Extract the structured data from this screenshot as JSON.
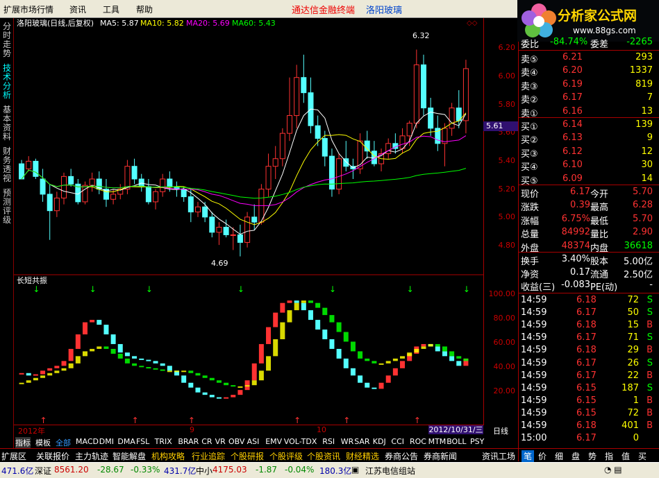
{
  "menu": [
    "扩展市场行情",
    "资讯",
    "工具",
    "帮助"
  ],
  "brand": {
    "left": "通达信金融终端",
    "right": "洛阳玻璃"
  },
  "logo": {
    "title": "分析家公式网",
    "url": "www.88gs.com"
  },
  "vtabs": [
    "分时走势",
    "技术分析",
    "基本资料",
    "财务透视",
    "预测评级"
  ],
  "chart": {
    "stock": "洛阳玻璃(日线,后复权)",
    "ma5": "MA5: 5.87",
    "ma10": "MA10: 5.82",
    "ma20": "MA20: 5.69",
    "ma60": "MA60: 5.43",
    "y_ticks": [
      "6.20",
      "6.00",
      "5.80",
      "5.60",
      "5.40",
      "5.20",
      "5.00",
      "4.80"
    ],
    "high_label": "6.32",
    "low_label": "4.69",
    "last_price": "5.61",
    "ind_title": "长短共振",
    "ind_ticks": [
      "100.00",
      "80.00",
      "60.00",
      "40.00",
      "20.00"
    ],
    "x_ticks": [
      "2012年",
      "9",
      "10"
    ],
    "date_box": "2012/10/31/三",
    "cycle": "日线"
  },
  "chart_data": {
    "type": "candlestick",
    "price_ylim": [
      4.6,
      6.35
    ],
    "indicator_ylim": [
      0,
      105
    ],
    "candles": [
      [
        5.42,
        5.45,
        5.33,
        5.3
      ],
      [
        5.38,
        5.48,
        5.36,
        5.44
      ],
      [
        5.44,
        5.46,
        5.3,
        5.32
      ],
      [
        5.3,
        5.38,
        5.12,
        5.18
      ],
      [
        5.18,
        5.26,
        4.82,
        5.05
      ],
      [
        5.05,
        5.2,
        5.0,
        5.15
      ],
      [
        5.15,
        5.35,
        5.1,
        5.32
      ],
      [
        5.32,
        5.38,
        5.24,
        5.26
      ],
      [
        5.26,
        5.3,
        5.1,
        5.12
      ],
      [
        5.12,
        5.28,
        5.1,
        5.25
      ],
      [
        5.25,
        5.35,
        5.2,
        5.3
      ],
      [
        5.3,
        5.36,
        5.18,
        5.22
      ],
      [
        5.22,
        5.3,
        5.08,
        5.14
      ],
      [
        5.14,
        5.22,
        5.1,
        5.18
      ],
      [
        5.18,
        5.26,
        5.14,
        5.22
      ],
      [
        5.22,
        5.45,
        5.18,
        5.4
      ],
      [
        5.4,
        5.46,
        5.26,
        5.3
      ],
      [
        5.3,
        5.34,
        5.2,
        5.24
      ],
      [
        5.24,
        5.3,
        5.1,
        5.12
      ],
      [
        5.12,
        5.22,
        5.06,
        5.2
      ],
      [
        5.2,
        5.34,
        5.16,
        5.3
      ],
      [
        5.3,
        5.36,
        5.2,
        5.24
      ],
      [
        5.24,
        5.28,
        5.16,
        5.22
      ],
      [
        5.22,
        5.24,
        5.12,
        5.16
      ],
      [
        5.16,
        5.22,
        4.96,
        5.04
      ],
      [
        5.04,
        5.12,
        5.0,
        5.08
      ],
      [
        5.08,
        5.12,
        4.96,
        5.0
      ],
      [
        5.0,
        5.04,
        4.84,
        4.88
      ],
      [
        4.88,
        4.96,
        4.78,
        4.92
      ],
      [
        4.92,
        4.98,
        4.84,
        4.86
      ],
      [
        4.86,
        4.92,
        4.74,
        4.86
      ],
      [
        4.86,
        4.94,
        4.69,
        4.8
      ],
      [
        4.8,
        5.04,
        4.76,
        5.0
      ],
      [
        5.0,
        5.1,
        4.9,
        4.96
      ],
      [
        4.96,
        5.26,
        4.94,
        5.22
      ],
      [
        5.22,
        5.5,
        5.16,
        5.4
      ],
      [
        5.4,
        5.56,
        5.3,
        5.46
      ],
      [
        5.46,
        5.7,
        5.4,
        5.66
      ],
      [
        5.66,
        6.1,
        5.6,
        5.8
      ],
      [
        5.8,
        6.2,
        5.7,
        6.1
      ],
      [
        6.1,
        6.28,
        5.9,
        5.98
      ],
      [
        5.98,
        6.1,
        5.66,
        5.72
      ],
      [
        5.72,
        5.8,
        5.56,
        5.62
      ],
      [
        5.62,
        5.68,
        5.4,
        5.48
      ],
      [
        5.48,
        5.54,
        5.16,
        5.22
      ],
      [
        5.22,
        5.5,
        5.18,
        5.46
      ],
      [
        5.46,
        5.6,
        5.36,
        5.4
      ],
      [
        5.4,
        5.46,
        5.3,
        5.38
      ],
      [
        5.38,
        5.66,
        5.34,
        5.6
      ],
      [
        5.6,
        5.68,
        5.46,
        5.52
      ],
      [
        5.52,
        5.6,
        5.4,
        5.42
      ],
      [
        5.42,
        5.54,
        5.36,
        5.5
      ],
      [
        5.5,
        5.62,
        5.46,
        5.58
      ],
      [
        5.58,
        5.66,
        5.5,
        5.54
      ],
      [
        5.54,
        5.7,
        5.5,
        5.64
      ],
      [
        5.64,
        5.76,
        5.56,
        5.74
      ],
      [
        5.74,
        6.32,
        5.7,
        6.2
      ],
      [
        6.2,
        6.28,
        5.8,
        5.86
      ],
      [
        5.86,
        5.94,
        5.64,
        5.7
      ],
      [
        5.7,
        5.8,
        5.52,
        5.58
      ],
      [
        5.58,
        5.74,
        5.4,
        5.7
      ],
      [
        5.7,
        5.9,
        5.64,
        5.86
      ],
      [
        5.86,
        6.0,
        5.7,
        5.76
      ],
      [
        5.76,
        6.24,
        5.66,
        6.17
      ]
    ],
    "indicator": [
      38,
      36,
      37,
      40,
      42,
      44,
      48,
      58,
      70,
      80,
      82,
      78,
      70,
      62,
      55,
      52,
      50,
      49,
      48,
      46,
      44,
      40,
      36,
      30,
      26,
      22,
      20,
      18,
      17,
      18,
      20,
      24,
      32,
      46,
      62,
      76,
      88,
      96,
      98,
      96,
      90,
      82,
      74,
      66,
      58,
      50,
      42,
      36,
      30,
      26,
      25,
      30,
      36,
      42,
      48,
      54,
      60,
      62,
      60,
      56,
      52,
      48,
      44,
      50
    ],
    "indicator_fast": [
      30,
      32,
      34,
      36,
      38,
      40,
      42,
      46,
      52,
      56,
      58,
      60,
      58,
      54,
      50,
      46,
      44,
      43,
      42,
      41,
      40,
      40,
      40,
      40,
      38,
      36,
      34,
      32,
      30,
      28,
      27,
      27,
      28,
      32,
      40,
      52,
      66,
      80,
      90,
      96,
      98,
      96,
      92,
      86,
      80,
      72,
      64,
      56,
      50,
      48,
      46,
      46,
      48,
      50,
      52,
      55,
      58,
      60,
      62,
      60,
      56,
      52,
      50,
      48
    ]
  },
  "right_panel": {
    "wb": {
      "label": "委比",
      "val": "-84.74%",
      "label2": "委差",
      "val2": "-2265"
    },
    "asks": [
      [
        "卖⑤",
        "6.21",
        "293"
      ],
      [
        "卖④",
        "6.20",
        "1337"
      ],
      [
        "卖③",
        "6.19",
        "819"
      ],
      [
        "卖②",
        "6.17",
        "7"
      ],
      [
        "卖①",
        "6.16",
        "13"
      ]
    ],
    "bids": [
      [
        "买①",
        "6.14",
        "139"
      ],
      [
        "买②",
        "6.13",
        "9"
      ],
      [
        "买③",
        "6.12",
        "12"
      ],
      [
        "买④",
        "6.10",
        "30"
      ],
      [
        "买⑤",
        "6.09",
        "14"
      ]
    ],
    "quote": [
      [
        "现价",
        "6.17",
        "今开",
        "5.70"
      ],
      [
        "涨跌",
        "0.39",
        "最高",
        "6.28"
      ],
      [
        "涨幅",
        "6.75%",
        "最低",
        "5.70"
      ],
      [
        "总量",
        "84992",
        "量比",
        "2.90"
      ],
      [
        "外盘",
        "48374",
        "内盘",
        "36618"
      ]
    ],
    "fund": [
      [
        "换手",
        "3.40%",
        "股本",
        "5.00亿"
      ],
      [
        "净资",
        "0.17",
        "流通",
        "2.50亿"
      ],
      [
        "收益(三)",
        "-0.083",
        "PE(动)",
        "-"
      ]
    ],
    "ticks": [
      [
        "14:59",
        "6.18",
        "72",
        "S"
      ],
      [
        "14:59",
        "6.17",
        "50",
        "S"
      ],
      [
        "14:59",
        "6.18",
        "15",
        "B"
      ],
      [
        "14:59",
        "6.17",
        "71",
        "S"
      ],
      [
        "14:59",
        "6.18",
        "29",
        "B"
      ],
      [
        "14:59",
        "6.17",
        "26",
        "S"
      ],
      [
        "14:59",
        "6.17",
        "22",
        "B"
      ],
      [
        "14:59",
        "6.15",
        "187",
        "S"
      ],
      [
        "14:59",
        "6.15",
        "1",
        "B"
      ],
      [
        "14:59",
        "6.15",
        "72",
        "B"
      ],
      [
        "14:59",
        "6.18",
        "401",
        "B"
      ],
      [
        "15:00",
        "6.17",
        "0",
        ""
      ]
    ]
  },
  "indicators": [
    "指标",
    "模板",
    "全部",
    "MACD",
    "DMI",
    "DMA",
    "FSL",
    "TRIX",
    "BRAR",
    "CR",
    "VR",
    "OBV",
    "ASI",
    "EMV",
    "VOL-TDX",
    "RSI",
    "WR",
    "SAR",
    "KDJ",
    "CCI",
    "ROC",
    "MTM",
    "BOLL",
    "PSY"
  ],
  "bottom_tabs": [
    "扩展区",
    "关联报价",
    "主力轨迹",
    "智能解盘",
    "机构攻略",
    "行业追踪",
    "个股研报",
    "个股评级",
    "个股资讯",
    "财经精选",
    "券商公告",
    "券商新闻",
    "资讯工场"
  ],
  "rb_tabs": [
    "笔",
    "价",
    "细",
    "盘",
    "势",
    "指",
    "值",
    "买"
  ],
  "status": {
    "s1": "471.6亿",
    "sz_label": "深证",
    "sz": "8561.20",
    "sz_chg": "-28.67",
    "sz_pct": "-0.33%",
    "amt2": "431.7亿",
    "zx_label": "中小",
    "zx": "4175.03",
    "zx_chg": "-1.87",
    "zx_pct": "-0.04%",
    "amt3": "180.3亿",
    "station": "江苏电信组站"
  }
}
